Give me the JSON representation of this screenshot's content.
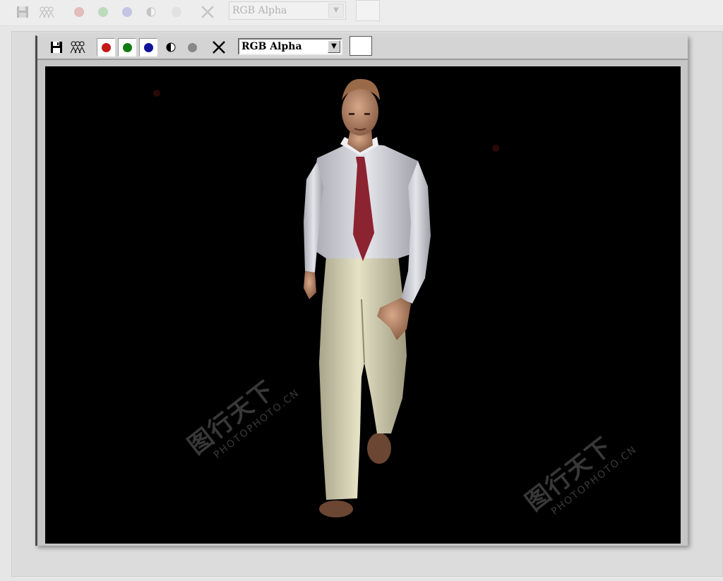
{
  "ghost_toolbar": {
    "channel_select": "RGB Alpha",
    "icons": [
      "save-icon",
      "clone-icon",
      "red-channel-icon",
      "green-channel-icon",
      "blue-channel-icon",
      "mono-icon",
      "alpha-icon",
      "clear-icon"
    ]
  },
  "render_toolbar": {
    "channel_select": "RGB Alpha",
    "colors": {
      "red": "#c41a1a",
      "green": "#127a12",
      "blue": "#12129a",
      "gray": "#888888"
    }
  },
  "watermark": {
    "cn": "图行天下",
    "en": "PHOTOPHOTO.CN"
  }
}
